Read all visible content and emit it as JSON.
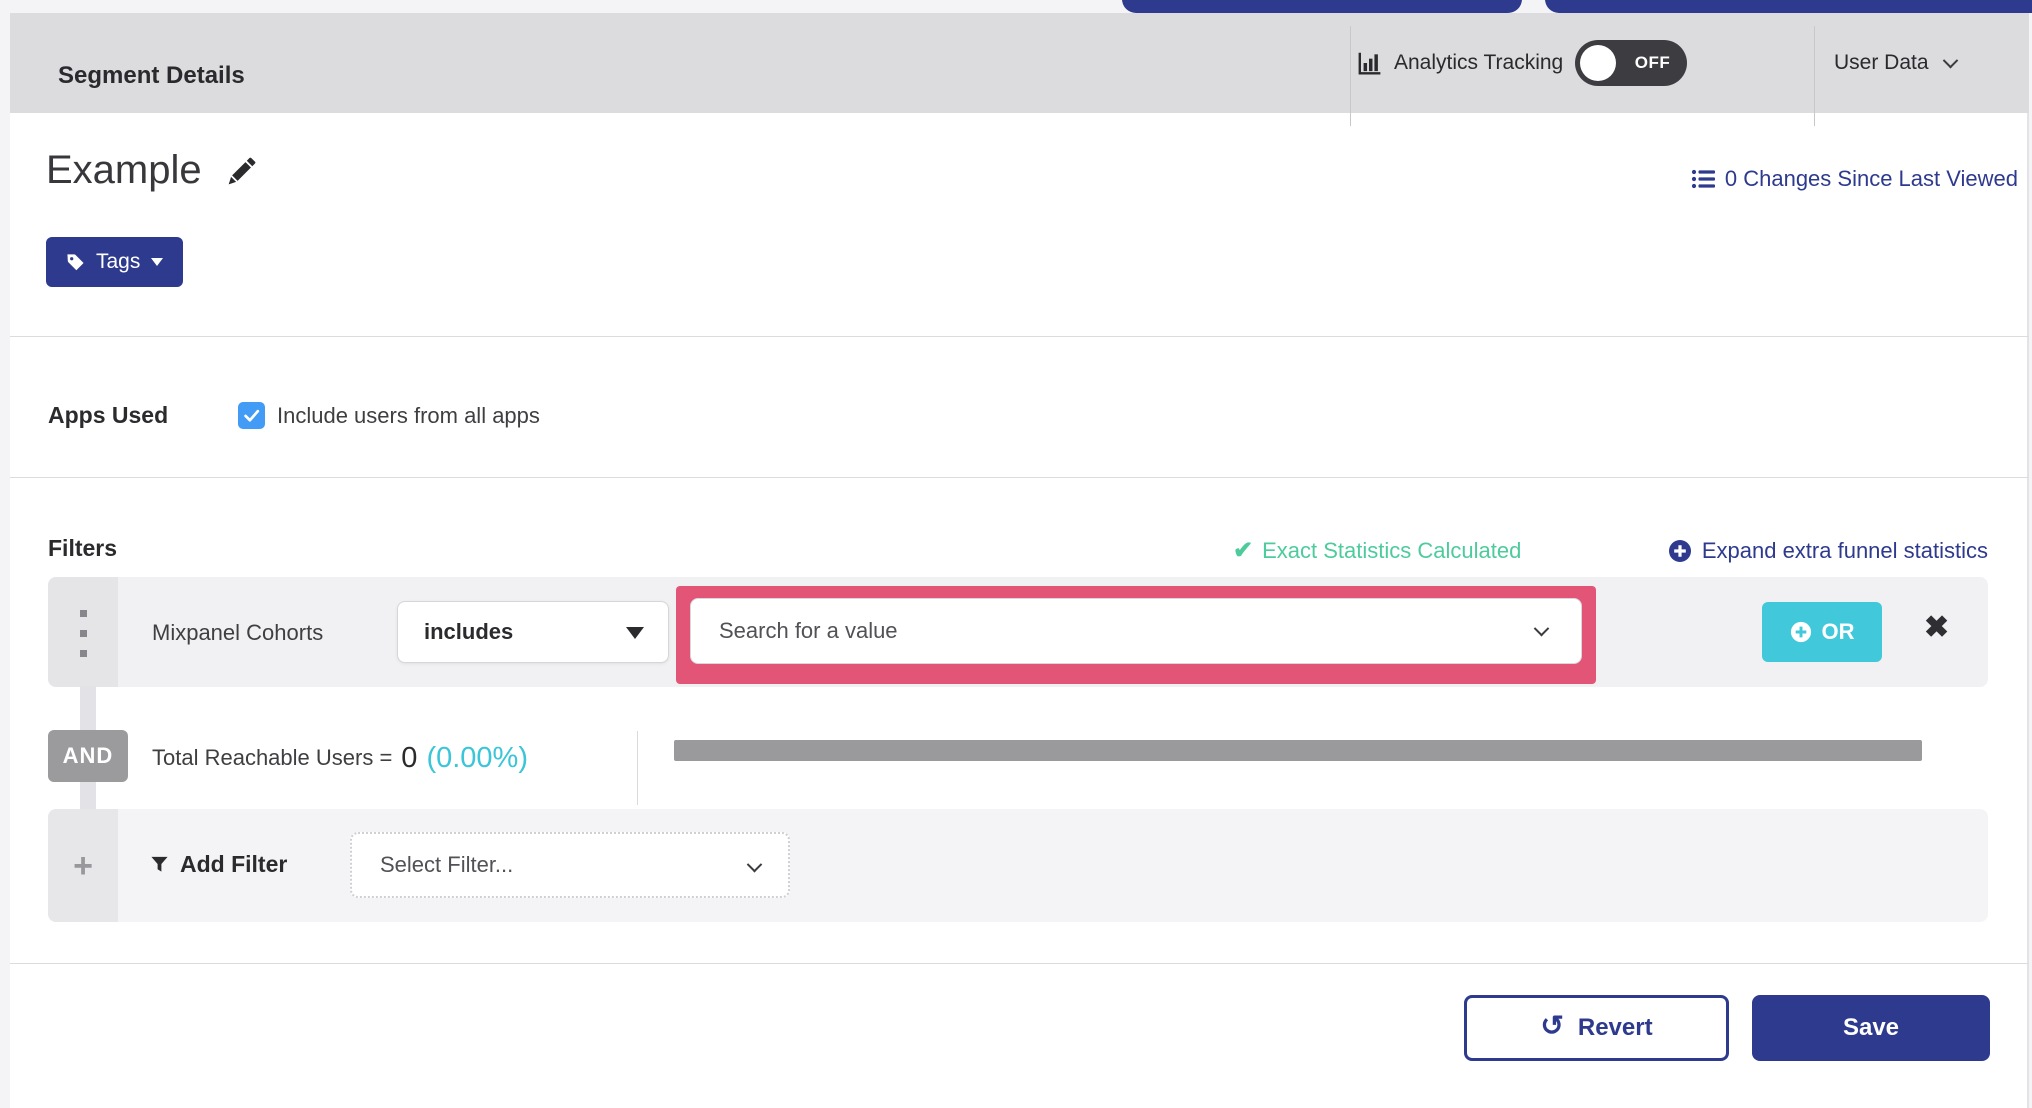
{
  "header": {
    "title": "Segment Details",
    "analytics_tracking_label": "Analytics Tracking",
    "toggle_state": "OFF",
    "user_data_label": "User Data"
  },
  "segment": {
    "name": "Example",
    "changes_link": "0 Changes Since Last Viewed",
    "tags_button": "Tags"
  },
  "apps_used": {
    "label": "Apps Used",
    "checkbox_label": "Include users from all apps",
    "checkbox_checked": true
  },
  "filters": {
    "heading": "Filters",
    "exact_stats_label": "Exact Statistics Calculated",
    "expand_funnel_label": "Expand extra funnel statistics",
    "row": {
      "field_label": "Mixpanel Cohorts",
      "operator_value": "includes",
      "value_placeholder": "Search for a value",
      "or_button": "OR"
    },
    "connector_label": "AND",
    "reachable": {
      "label": "Total Reachable Users =",
      "value": "0",
      "percent": "(0.00%)"
    },
    "add_filter": {
      "label": "Add Filter",
      "select_placeholder": "Select Filter..."
    }
  },
  "footer": {
    "revert_button": "Revert",
    "save_button": "Save"
  },
  "icons": {
    "analytics": "bar-chart-icon",
    "changes": "list-icon",
    "tags": "tag-icon",
    "edit": "pencil-icon",
    "exact": "check-icon",
    "expand": "plus-circle-icon",
    "or": "plus-circle-icon",
    "close": "x-icon",
    "add_filter": "funnel-icon",
    "revert": "rotate-ccw-icon"
  },
  "colors": {
    "brand_indigo": "#2d3a8e",
    "header_gray": "#dcdcdf",
    "teal_button": "#41c9db",
    "mint_success": "#4ecb9c",
    "cyan_percent": "#3bc5d8",
    "highlight_pink": "#e25577",
    "checkbox_blue": "#429bf4",
    "toggle_off_bg": "#3d3d41"
  }
}
